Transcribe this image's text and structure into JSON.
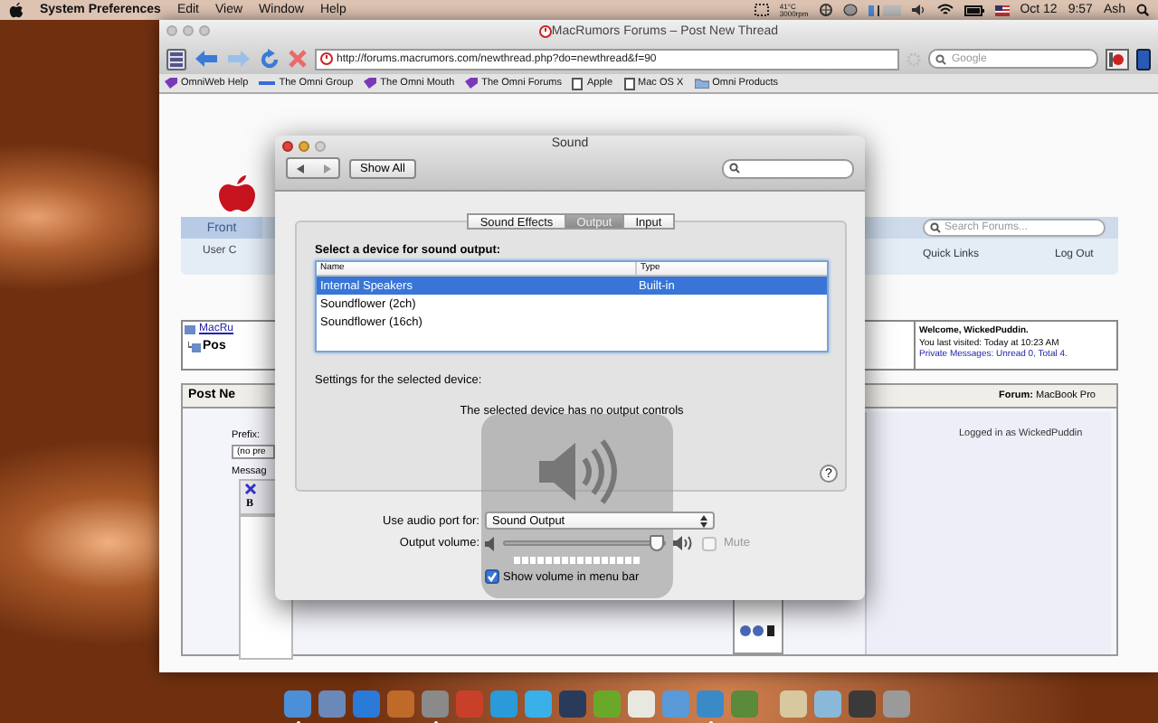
{
  "menu_bar": {
    "app": "System Preferences",
    "menus": [
      "Edit",
      "View",
      "Window",
      "Help"
    ],
    "temperature": "41°C",
    "fan_speed": "3000rpm",
    "date": "Oct 12",
    "time": "9:57",
    "user": "Ash"
  },
  "browser": {
    "title": "MacRumors Forums – Post New Thread",
    "url": "http://forums.macrumors.com/newthread.php?do=newthread&f=90",
    "search": {
      "placeholder": "Google"
    },
    "bookmarks": [
      {
        "label": "OmniWeb Help",
        "kind": "tag"
      },
      {
        "label": "The Omni Group",
        "kind": "bar"
      },
      {
        "label": "The Omni Mouth",
        "kind": "tag"
      },
      {
        "label": "The Omni Forums",
        "kind": "tag"
      },
      {
        "label": "Apple",
        "kind": "page"
      },
      {
        "label": "Mac OS X",
        "kind": "page"
      },
      {
        "label": "Omni Products",
        "kind": "folder"
      }
    ]
  },
  "forum": {
    "nav_tab": "Front",
    "nav_link": "User C",
    "search": {
      "placeholder": "Search Forums..."
    },
    "quick_links": "Quick Links",
    "logout": "Log Out",
    "breadcrumb": [
      "MacRu",
      "Pos"
    ],
    "welcome": "Welcome, WickedPuddin.",
    "last_visit": "You last visited: Today at 10:23 AM",
    "private_messages": "Private Messages: Unread 0, Total 4.",
    "post_header": "Post Ne",
    "forum_label": "**Forum:** MacBook Pro",
    "prefix_label": "Prefix:",
    "prefix_value": "(no pre",
    "message_label": "Messag",
    "bold_button": "B",
    "logged_in": "Logged in as WickedPuddin"
  },
  "sound": {
    "title": "Sound",
    "show_all": "Show All",
    "tabs": [
      {
        "label": "Sound Effects",
        "selected": false
      },
      {
        "label": "Output",
        "selected": true
      },
      {
        "label": "Input",
        "selected": false
      }
    ],
    "prompt": "Select a device for sound output:",
    "columns": [
      "Name",
      "Type"
    ],
    "rows": [
      {
        "name": "Internal Speakers",
        "type": "Built-in",
        "selected": true
      },
      {
        "name": "Soundflower (2ch)",
        "selected": false
      },
      {
        "name": "Soundflower (16ch)",
        "selected": false
      }
    ],
    "settings_label": "Settings for the selected device:",
    "no_controls": "The selected device has no output controls",
    "help": "?",
    "port_label": "Use audio port for:",
    "port_value": "Sound Output",
    "volume_label": "Output volume:",
    "volume": {
      "level": 0.95
    },
    "mute": {
      "label": "Mute",
      "checked": false,
      "disabled": true
    },
    "menu_checkbox": {
      "label": "Show volume in menu bar",
      "checked": true
    },
    "hud": {
      "level": 1
    }
  },
  "dock": {
    "apps": [
      {
        "color": "#4a8fd8",
        "running": true
      },
      {
        "color": "#6a88b8",
        "running": false
      },
      {
        "color": "#2a7ad8",
        "running": false
      },
      {
        "color": "#c06a2a",
        "running": false
      },
      {
        "color": "#8a8a8a",
        "running": true
      },
      {
        "color": "#c8402a",
        "running": false
      },
      {
        "color": "#2a9ad8",
        "running": false
      },
      {
        "color": "#3ab0e8",
        "running": false
      },
      {
        "color": "#2a3a5a",
        "running": false
      },
      {
        "color": "#6aa82a",
        "running": false
      },
      {
        "color": "#e8e8e0",
        "running": false
      },
      {
        "color": "#5a9ad8",
        "running": false
      },
      {
        "color": "#3a8ac8",
        "running": true
      },
      {
        "color": "#5a8a3a",
        "running": false
      }
    ],
    "stacks": [
      {
        "color": "#d8c8a0",
        "running": false
      },
      {
        "color": "#8ab8d8",
        "running": false
      },
      {
        "color": "#3a3a3a",
        "running": false
      },
      {
        "color": "#9a9a9a",
        "running": false
      }
    ]
  }
}
